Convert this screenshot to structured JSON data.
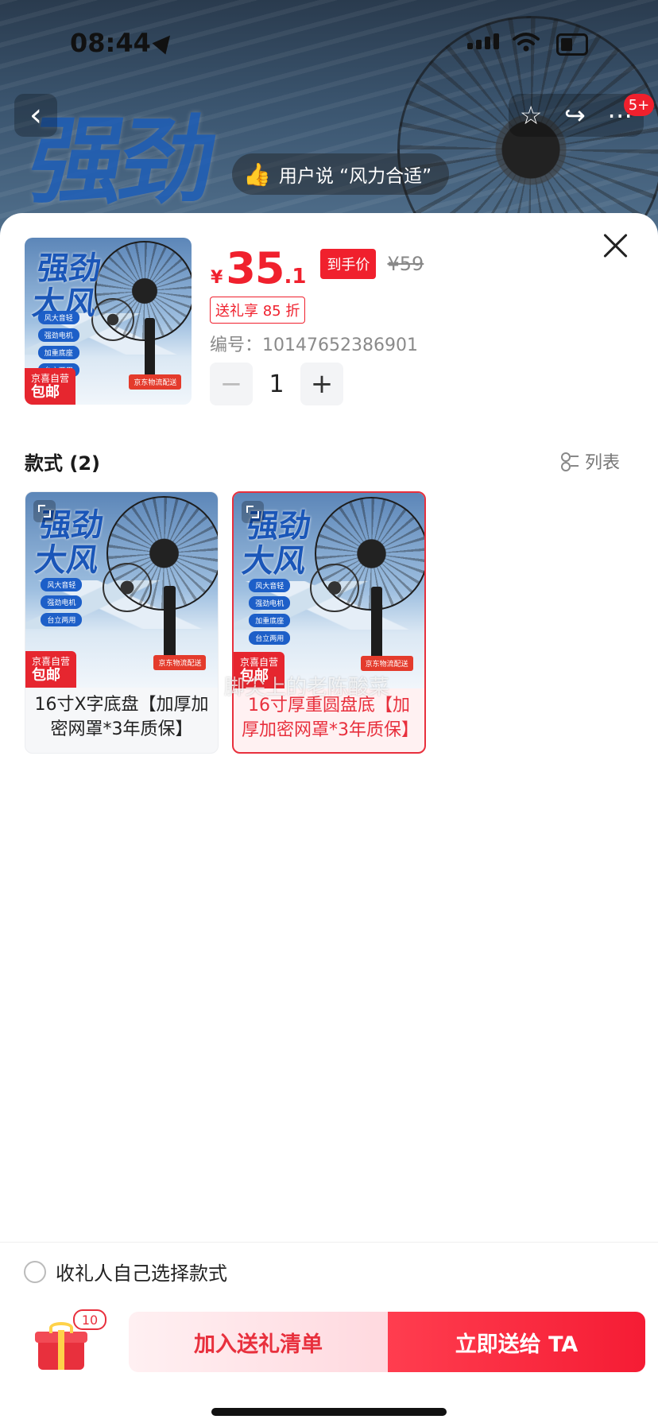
{
  "status_bar": {
    "time": "08:44"
  },
  "header": {
    "hero_text": "强劲",
    "cart_badge": "5+",
    "review_pill": "用户说 “风力合适”"
  },
  "product": {
    "currency": "¥",
    "price_int": "35",
    "price_dec": ".1",
    "price_tag": "到手价",
    "original_price": "¥59",
    "coupon": "送礼享 85 折",
    "code": "编号：10147652386901",
    "quantity": "1",
    "minus": "−",
    "plus": "+"
  },
  "image_art": {
    "headline_1": "强劲",
    "headline_2": "大风",
    "bullets": [
      "风大音轻",
      "强劲电机",
      "加重底座",
      "台立两用"
    ],
    "ship_tag": "京东物流配送",
    "self_tag_top": "京喜自营",
    "self_tag_bottom": "包邮"
  },
  "styles": {
    "title": "款式 (2)",
    "list_toggle": "列表",
    "variants": [
      {
        "name": "16寸X字底盘【加厚加密网罩*3年质保】"
      },
      {
        "name": "16寸厚重圆盘底【加厚加密网罩*3年质保】"
      }
    ],
    "watermark": "脚尖上的老陈酸菜"
  },
  "footer": {
    "choose_label": "收礼人自己选择款式",
    "gift_count": "10",
    "add_button": "加入送礼清单",
    "send_button": "立即送给 TA"
  },
  "colors": {
    "accent": "#f0202d",
    "selected_border": "#e8303d"
  }
}
